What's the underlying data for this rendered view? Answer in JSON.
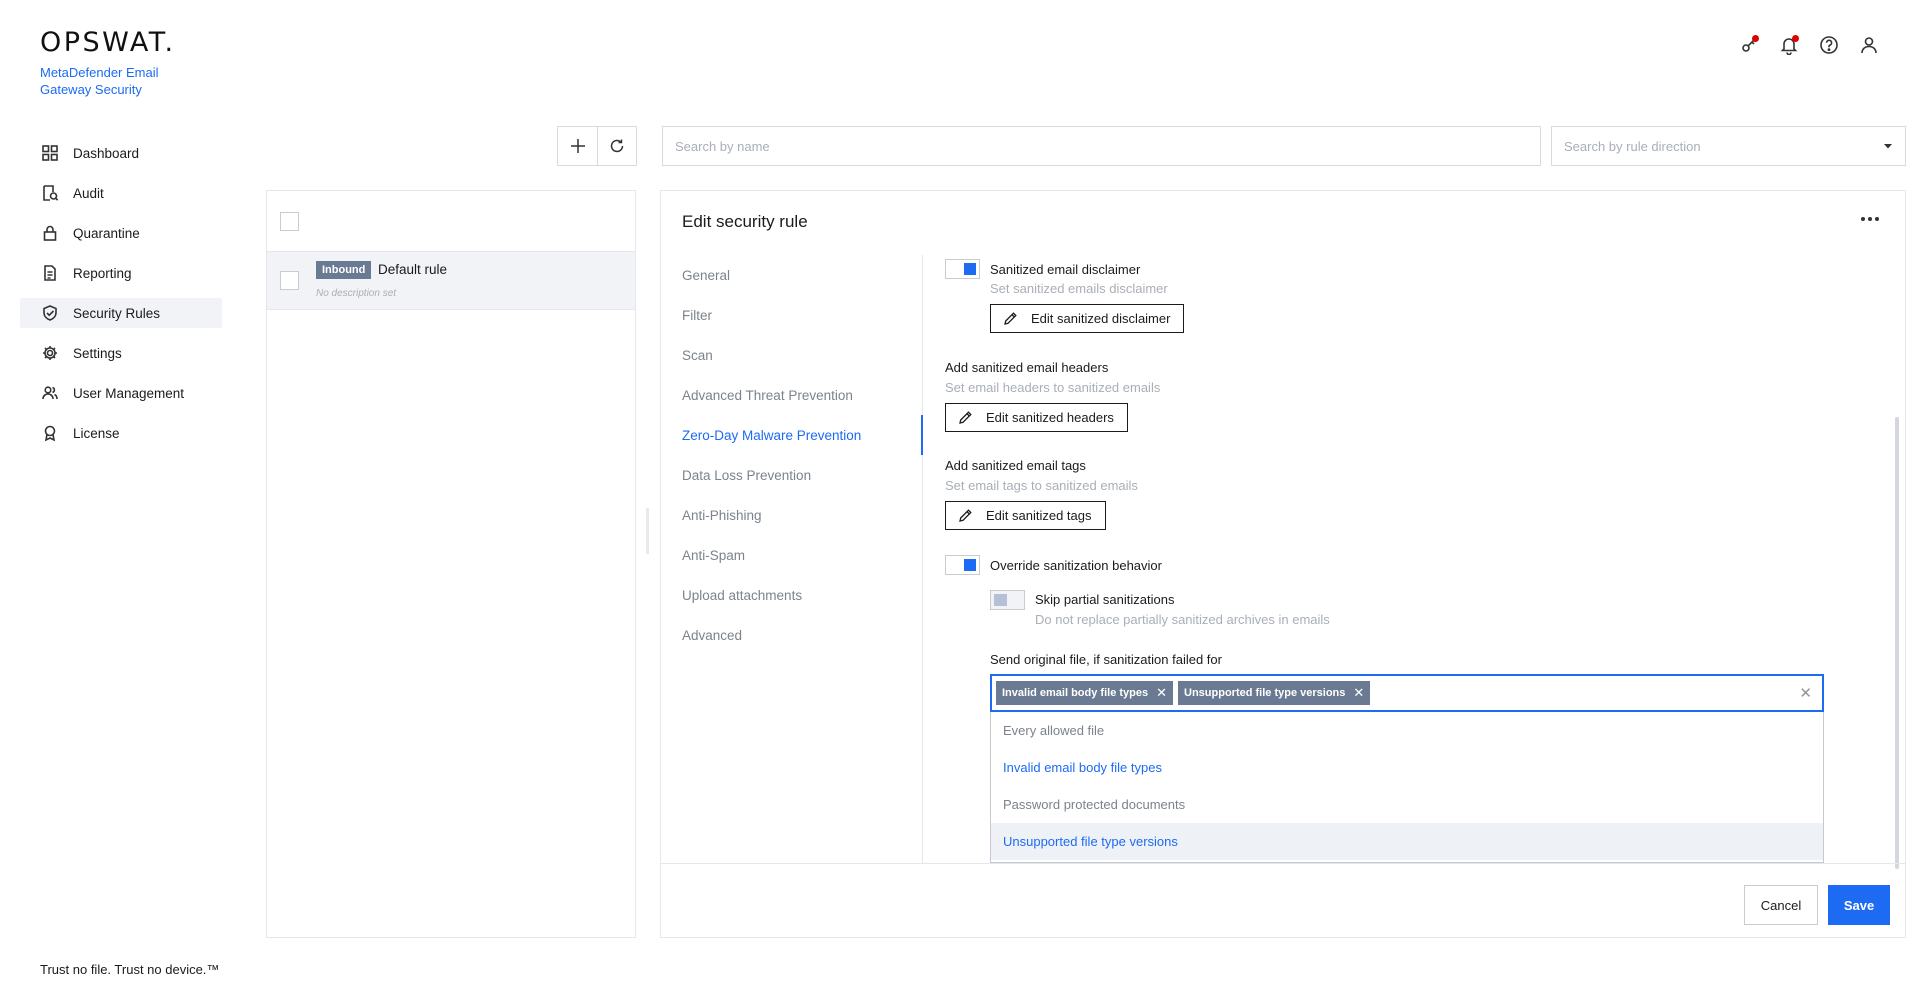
{
  "brand": {
    "logo_text": "OPSWAT.",
    "product_name": "MetaDefender Email Gateway Security",
    "tagline": "Trust no file. Trust no device.™",
    "accent_color": "#1d6bf3"
  },
  "sidebar": {
    "items": [
      {
        "label": "Dashboard",
        "icon": "grid-icon",
        "active": false
      },
      {
        "label": "Audit",
        "icon": "audit-icon",
        "active": false
      },
      {
        "label": "Quarantine",
        "icon": "lock-icon",
        "active": false
      },
      {
        "label": "Reporting",
        "icon": "document-icon",
        "active": false
      },
      {
        "label": "Security Rules",
        "icon": "shield-check-icon",
        "active": true
      },
      {
        "label": "Settings",
        "icon": "gear-icon",
        "active": false
      },
      {
        "label": "User Management",
        "icon": "users-icon",
        "active": false
      },
      {
        "label": "License",
        "icon": "award-icon",
        "active": false
      }
    ]
  },
  "header": {
    "icons": [
      "key-icon",
      "bell-icon",
      "help-icon",
      "user-icon"
    ],
    "notification_color": "#e00000"
  },
  "toolbar": {
    "add_icon": "plus-icon",
    "refresh_icon": "refresh-icon",
    "search_placeholder": "Search by name",
    "direction_placeholder": "Search by rule direction"
  },
  "rules": [
    {
      "badge": "Inbound",
      "name": "Default rule",
      "description": "No description set"
    }
  ],
  "editor": {
    "title": "Edit security rule",
    "tabs": [
      {
        "label": "General",
        "active": false
      },
      {
        "label": "Filter",
        "active": false
      },
      {
        "label": "Scan",
        "active": false
      },
      {
        "label": "Advanced Threat Prevention",
        "active": false
      },
      {
        "label": "Zero-Day Malware Prevention",
        "active": true
      },
      {
        "label": "Data Loss Prevention",
        "active": false
      },
      {
        "label": "Anti-Phishing",
        "active": false
      },
      {
        "label": "Anti-Spam",
        "active": false
      },
      {
        "label": "Upload attachments",
        "active": false
      },
      {
        "label": "Advanced",
        "active": false
      }
    ],
    "disclaimer": {
      "label": "Sanitized email disclaimer",
      "description": "Set sanitized emails disclaimer",
      "button": "Edit sanitized disclaimer",
      "enabled": true
    },
    "headers": {
      "label": "Add sanitized email headers",
      "description": "Set email headers to sanitized emails",
      "button": "Edit sanitized headers"
    },
    "tags": {
      "label": "Add sanitized email tags",
      "description": "Set email tags to sanitized emails",
      "button": "Edit sanitized tags"
    },
    "override": {
      "label": "Override sanitization behavior",
      "enabled": true
    },
    "skip_partial": {
      "label": "Skip partial sanitizations",
      "description": "Do not replace partially sanitized archives in emails",
      "enabled": false
    },
    "send_original": {
      "label": "Send original file, if sanitization failed for",
      "selected": [
        "Invalid email body file types",
        "Unsupported file type versions"
      ],
      "options": [
        {
          "label": "Every allowed file",
          "selected": false,
          "highlighted": false
        },
        {
          "label": "Invalid email body file types",
          "selected": true,
          "highlighted": false
        },
        {
          "label": "Password protected documents",
          "selected": false,
          "highlighted": false
        },
        {
          "label": "Unsupported file type versions",
          "selected": true,
          "highlighted": true
        }
      ]
    },
    "cancel_label": "Cancel",
    "save_label": "Save"
  }
}
